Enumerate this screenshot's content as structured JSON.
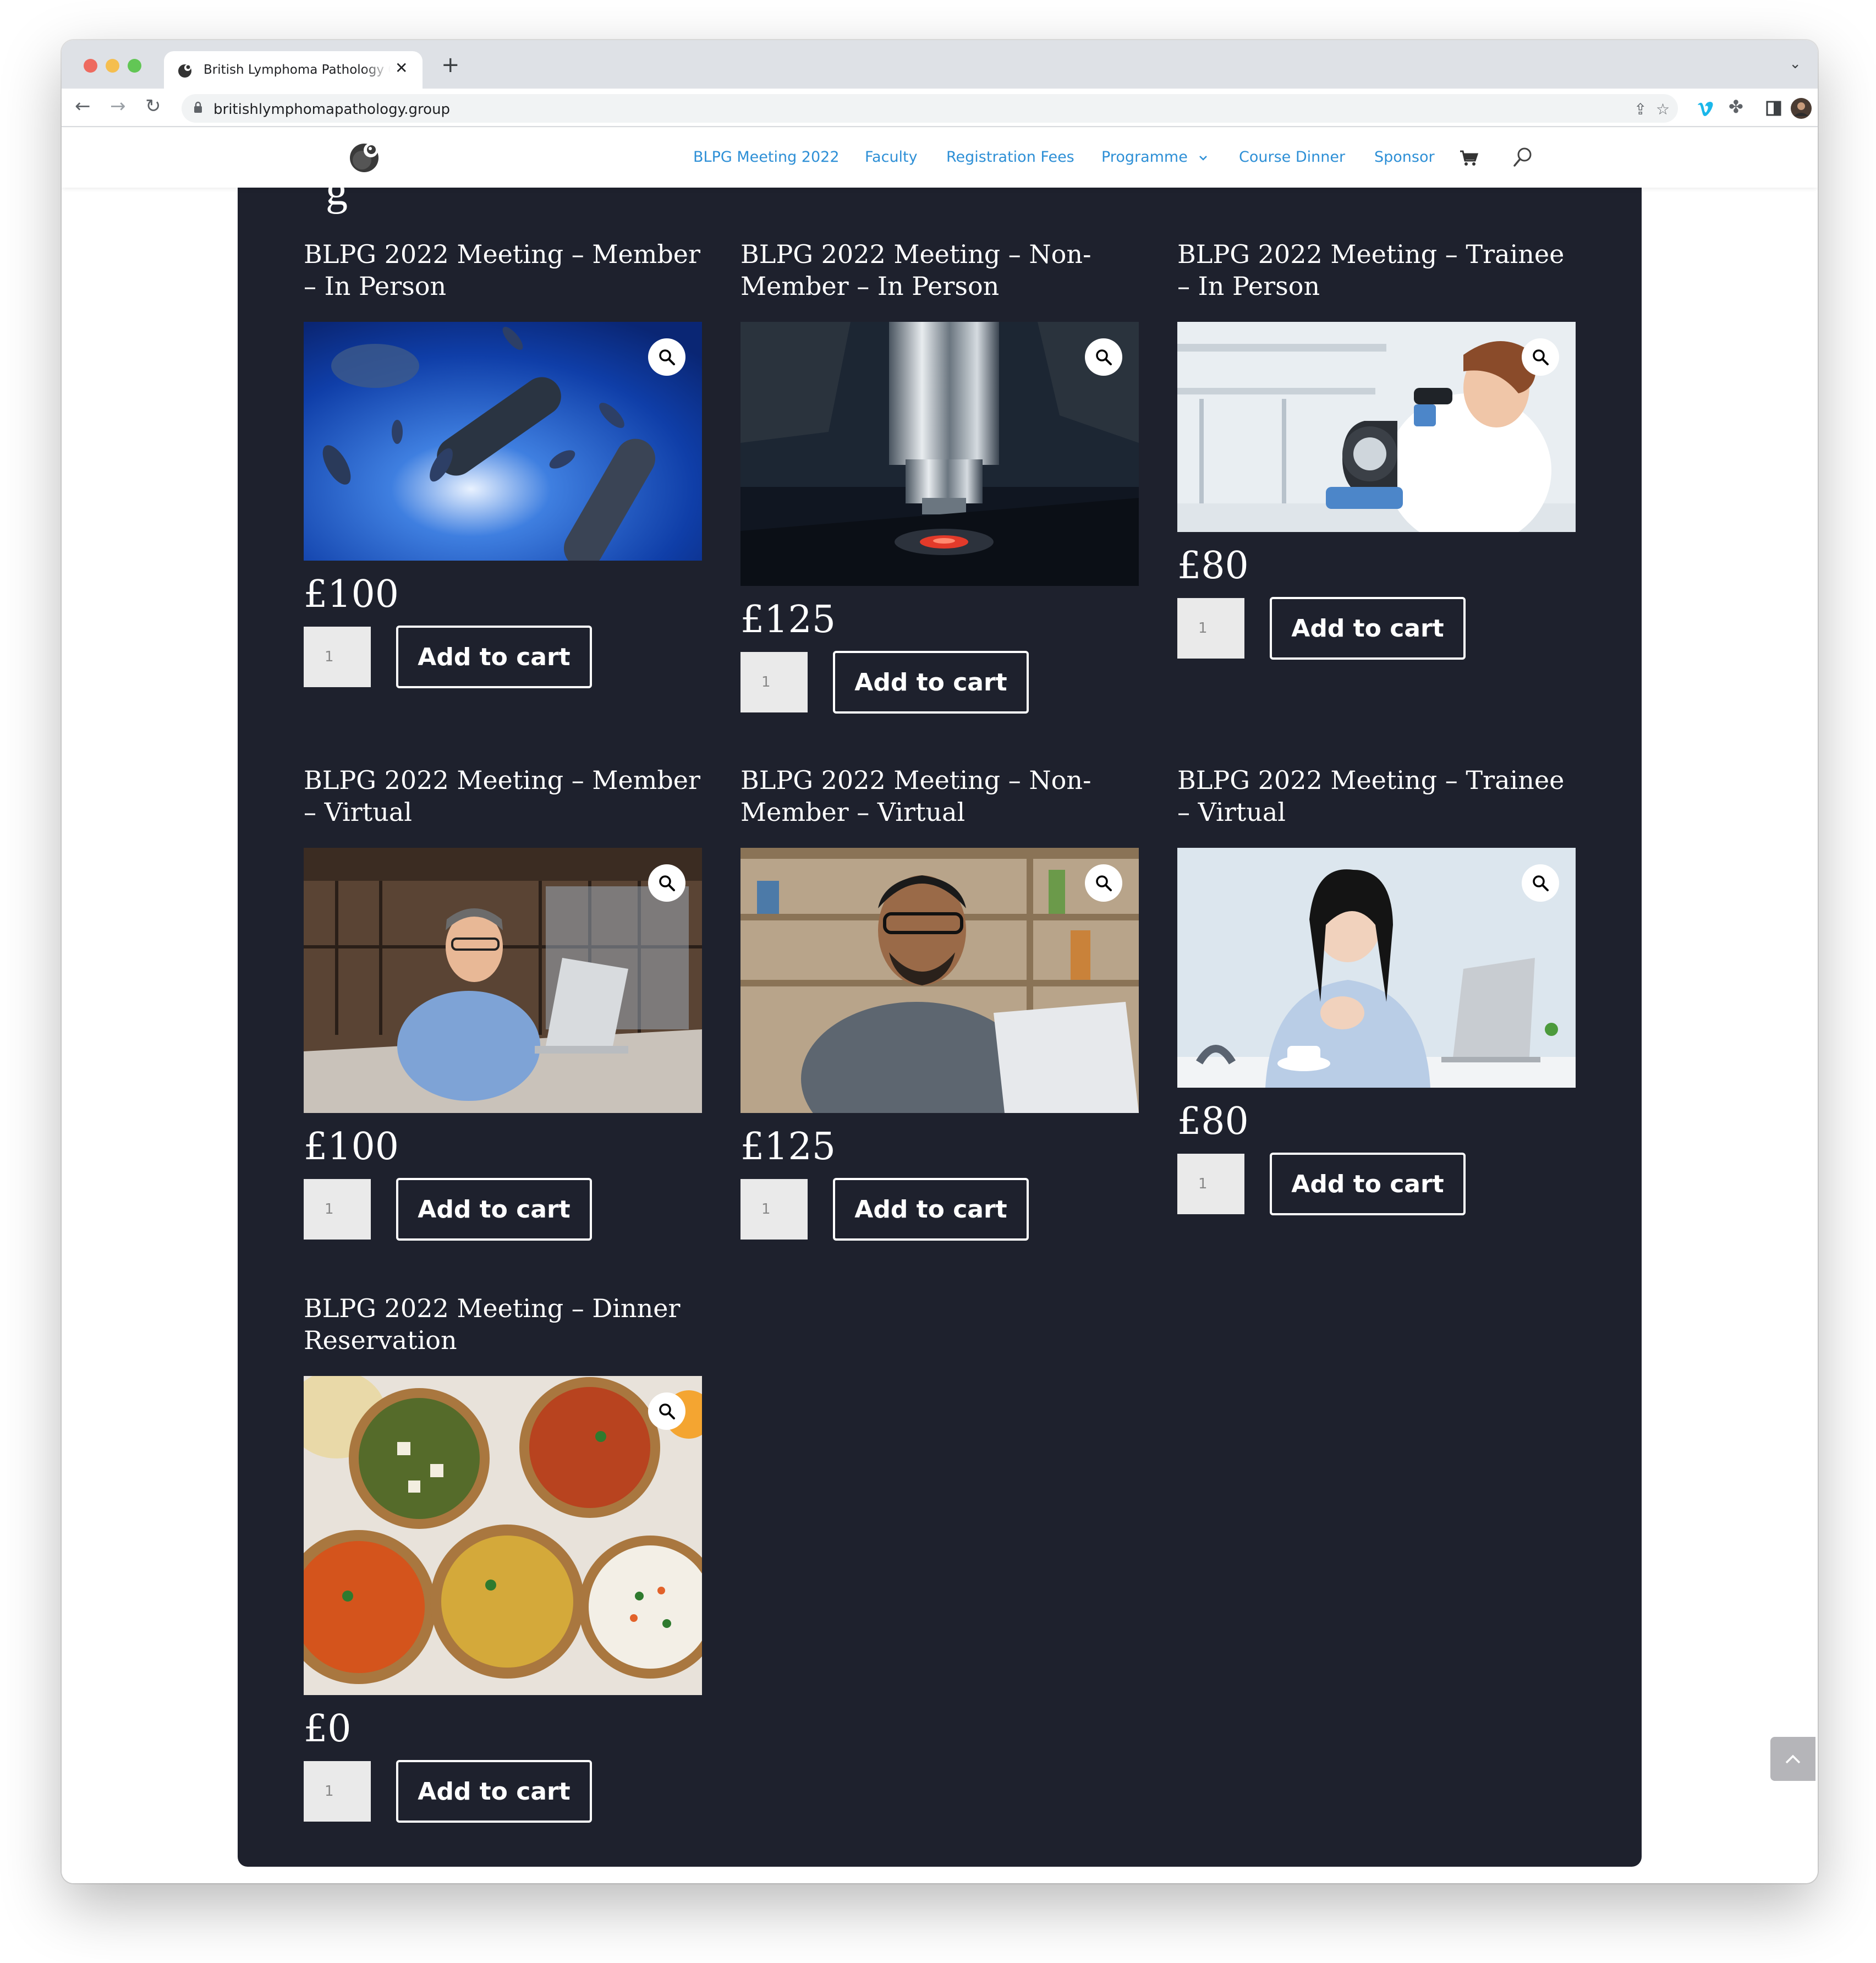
{
  "browser": {
    "tab_title": "British Lymphoma Pathology Group",
    "tab_close": "✕",
    "new_tab": "+",
    "url": "britishlymphomapathology.group",
    "icons": [
      "back-icon",
      "forward-icon",
      "reload-icon",
      "lock-icon",
      "share-icon",
      "star-icon",
      "vimeo-icon",
      "extensions-icon",
      "side-panel-icon",
      "profile-icon",
      "menu-icon"
    ]
  },
  "nav": {
    "items": [
      "BLPG Meeting 2022",
      "Faculty",
      "Registration Fees",
      "Programme",
      "Course Dinner",
      "Sponsor"
    ],
    "accent": "#2d8fd6"
  },
  "colors": {
    "panel_bg": "#1e212d",
    "text": "#ffffff"
  },
  "products": [
    {
      "title": "BLPG 2022 Meeting – Member – In Person",
      "price": "£100",
      "qty": "1",
      "button": "Add to cart",
      "image": "blue bacteria illustration"
    },
    {
      "title": "BLPG 2022 Meeting – Non-Member – In Person",
      "price": "£125",
      "qty": "1",
      "button": "Add to cart",
      "image": "microscope objective lens with red light"
    },
    {
      "title": "BLPG 2022 Meeting – Trainee – In Person",
      "price": "£80",
      "qty": "1",
      "button": "Add to cart",
      "image": "scientist looking into microscope in lab"
    },
    {
      "title": "BLPG 2022 Meeting – Member – Virtual",
      "price": "£100",
      "qty": "1",
      "button": "Add to cart",
      "image": "man in office smiling at laptop"
    },
    {
      "title": "BLPG 2022 Meeting – Non-Member – Virtual",
      "price": "£125",
      "qty": "1",
      "button": "Add to cart",
      "image": "man with headset on video call"
    },
    {
      "title": "BLPG 2022 Meeting – Trainee – Virtual",
      "price": "£80",
      "qty": "1",
      "button": "Add to cart",
      "image": "woman at desk with laptop"
    },
    {
      "title": "BLPG 2022 Meeting – Dinner Reservation",
      "price": "£0",
      "qty": "1",
      "button": "Add to cart",
      "image": "bowls of indian curry dishes"
    }
  ]
}
